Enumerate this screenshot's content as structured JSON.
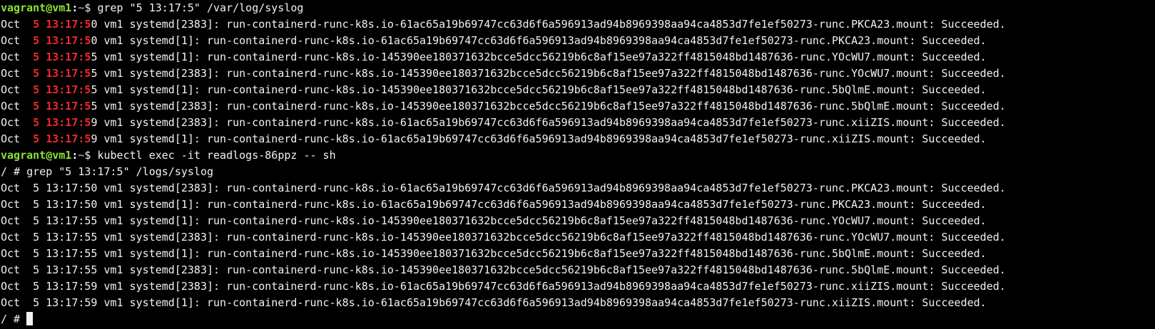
{
  "colors": {
    "background": "#000000",
    "text": "#f2f2f2",
    "prompt_user": "#8ae234",
    "prompt_path": "#729fcf",
    "grep_match": "#ef2929"
  },
  "prompt1": {
    "user_host": "vagrant@vm1",
    "separator": ":",
    "path": "~",
    "symbol": "$ ",
    "command": "grep \"5 13:17:5\" /var/log/syslog"
  },
  "host_output": [
    {
      "pre": "Oct  ",
      "match": "5 13:17:5",
      "post": "0 vm1 systemd[2383]: run-containerd-runc-k8s.io-61ac65a19b69747cc63d6f6a596913ad94b8969398aa94ca4853d7fe1ef50273-runc.PKCA23.mount: Succeeded."
    },
    {
      "pre": "Oct  ",
      "match": "5 13:17:5",
      "post": "0 vm1 systemd[1]: run-containerd-runc-k8s.io-61ac65a19b69747cc63d6f6a596913ad94b8969398aa94ca4853d7fe1ef50273-runc.PKCA23.mount: Succeeded."
    },
    {
      "pre": "Oct  ",
      "match": "5 13:17:5",
      "post": "5 vm1 systemd[1]: run-containerd-runc-k8s.io-145390ee180371632bcce5dcc56219b6c8af15ee97a322ff4815048bd1487636-runc.YOcWU7.mount: Succeeded."
    },
    {
      "pre": "Oct  ",
      "match": "5 13:17:5",
      "post": "5 vm1 systemd[2383]: run-containerd-runc-k8s.io-145390ee180371632bcce5dcc56219b6c8af15ee97a322ff4815048bd1487636-runc.YOcWU7.mount: Succeeded."
    },
    {
      "pre": "Oct  ",
      "match": "5 13:17:5",
      "post": "5 vm1 systemd[1]: run-containerd-runc-k8s.io-145390ee180371632bcce5dcc56219b6c8af15ee97a322ff4815048bd1487636-runc.5bQlmE.mount: Succeeded."
    },
    {
      "pre": "Oct  ",
      "match": "5 13:17:5",
      "post": "5 vm1 systemd[2383]: run-containerd-runc-k8s.io-145390ee180371632bcce5dcc56219b6c8af15ee97a322ff4815048bd1487636-runc.5bQlmE.mount: Succeeded."
    },
    {
      "pre": "Oct  ",
      "match": "5 13:17:5",
      "post": "9 vm1 systemd[2383]: run-containerd-runc-k8s.io-61ac65a19b69747cc63d6f6a596913ad94b8969398aa94ca4853d7fe1ef50273-runc.xiiZIS.mount: Succeeded."
    },
    {
      "pre": "Oct  ",
      "match": "5 13:17:5",
      "post": "9 vm1 systemd[1]: run-containerd-runc-k8s.io-61ac65a19b69747cc63d6f6a596913ad94b8969398aa94ca4853d7fe1ef50273-runc.xiiZIS.mount: Succeeded."
    }
  ],
  "prompt2": {
    "user_host": "vagrant@vm1",
    "separator": ":",
    "path": "~",
    "symbol": "$ ",
    "command": "kubectl exec -it readlogs-86ppz -- sh"
  },
  "container_prompt": {
    "text": "/ # ",
    "command": "grep \"5 13:17:5\" /logs/syslog"
  },
  "container_output": [
    "Oct  5 13:17:50 vm1 systemd[2383]: run-containerd-runc-k8s.io-61ac65a19b69747cc63d6f6a596913ad94b8969398aa94ca4853d7fe1ef50273-runc.PKCA23.mount: Succeeded.",
    "Oct  5 13:17:50 vm1 systemd[1]: run-containerd-runc-k8s.io-61ac65a19b69747cc63d6f6a596913ad94b8969398aa94ca4853d7fe1ef50273-runc.PKCA23.mount: Succeeded.",
    "Oct  5 13:17:55 vm1 systemd[1]: run-containerd-runc-k8s.io-145390ee180371632bcce5dcc56219b6c8af15ee97a322ff4815048bd1487636-runc.YOcWU7.mount: Succeeded.",
    "Oct  5 13:17:55 vm1 systemd[2383]: run-containerd-runc-k8s.io-145390ee180371632bcce5dcc56219b6c8af15ee97a322ff4815048bd1487636-runc.YOcWU7.mount: Succeeded.",
    "Oct  5 13:17:55 vm1 systemd[1]: run-containerd-runc-k8s.io-145390ee180371632bcce5dcc56219b6c8af15ee97a322ff4815048bd1487636-runc.5bQlmE.mount: Succeeded.",
    "Oct  5 13:17:55 vm1 systemd[2383]: run-containerd-runc-k8s.io-145390ee180371632bcce5dcc56219b6c8af15ee97a322ff4815048bd1487636-runc.5bQlmE.mount: Succeeded.",
    "Oct  5 13:17:59 vm1 systemd[2383]: run-containerd-runc-k8s.io-61ac65a19b69747cc63d6f6a596913ad94b8969398aa94ca4853d7fe1ef50273-runc.xiiZIS.mount: Succeeded.",
    "Oct  5 13:17:59 vm1 systemd[1]: run-containerd-runc-k8s.io-61ac65a19b69747cc63d6f6a596913ad94b8969398aa94ca4853d7fe1ef50273-runc.xiiZIS.mount: Succeeded."
  ],
  "final_prompt": {
    "text": "/ # "
  }
}
